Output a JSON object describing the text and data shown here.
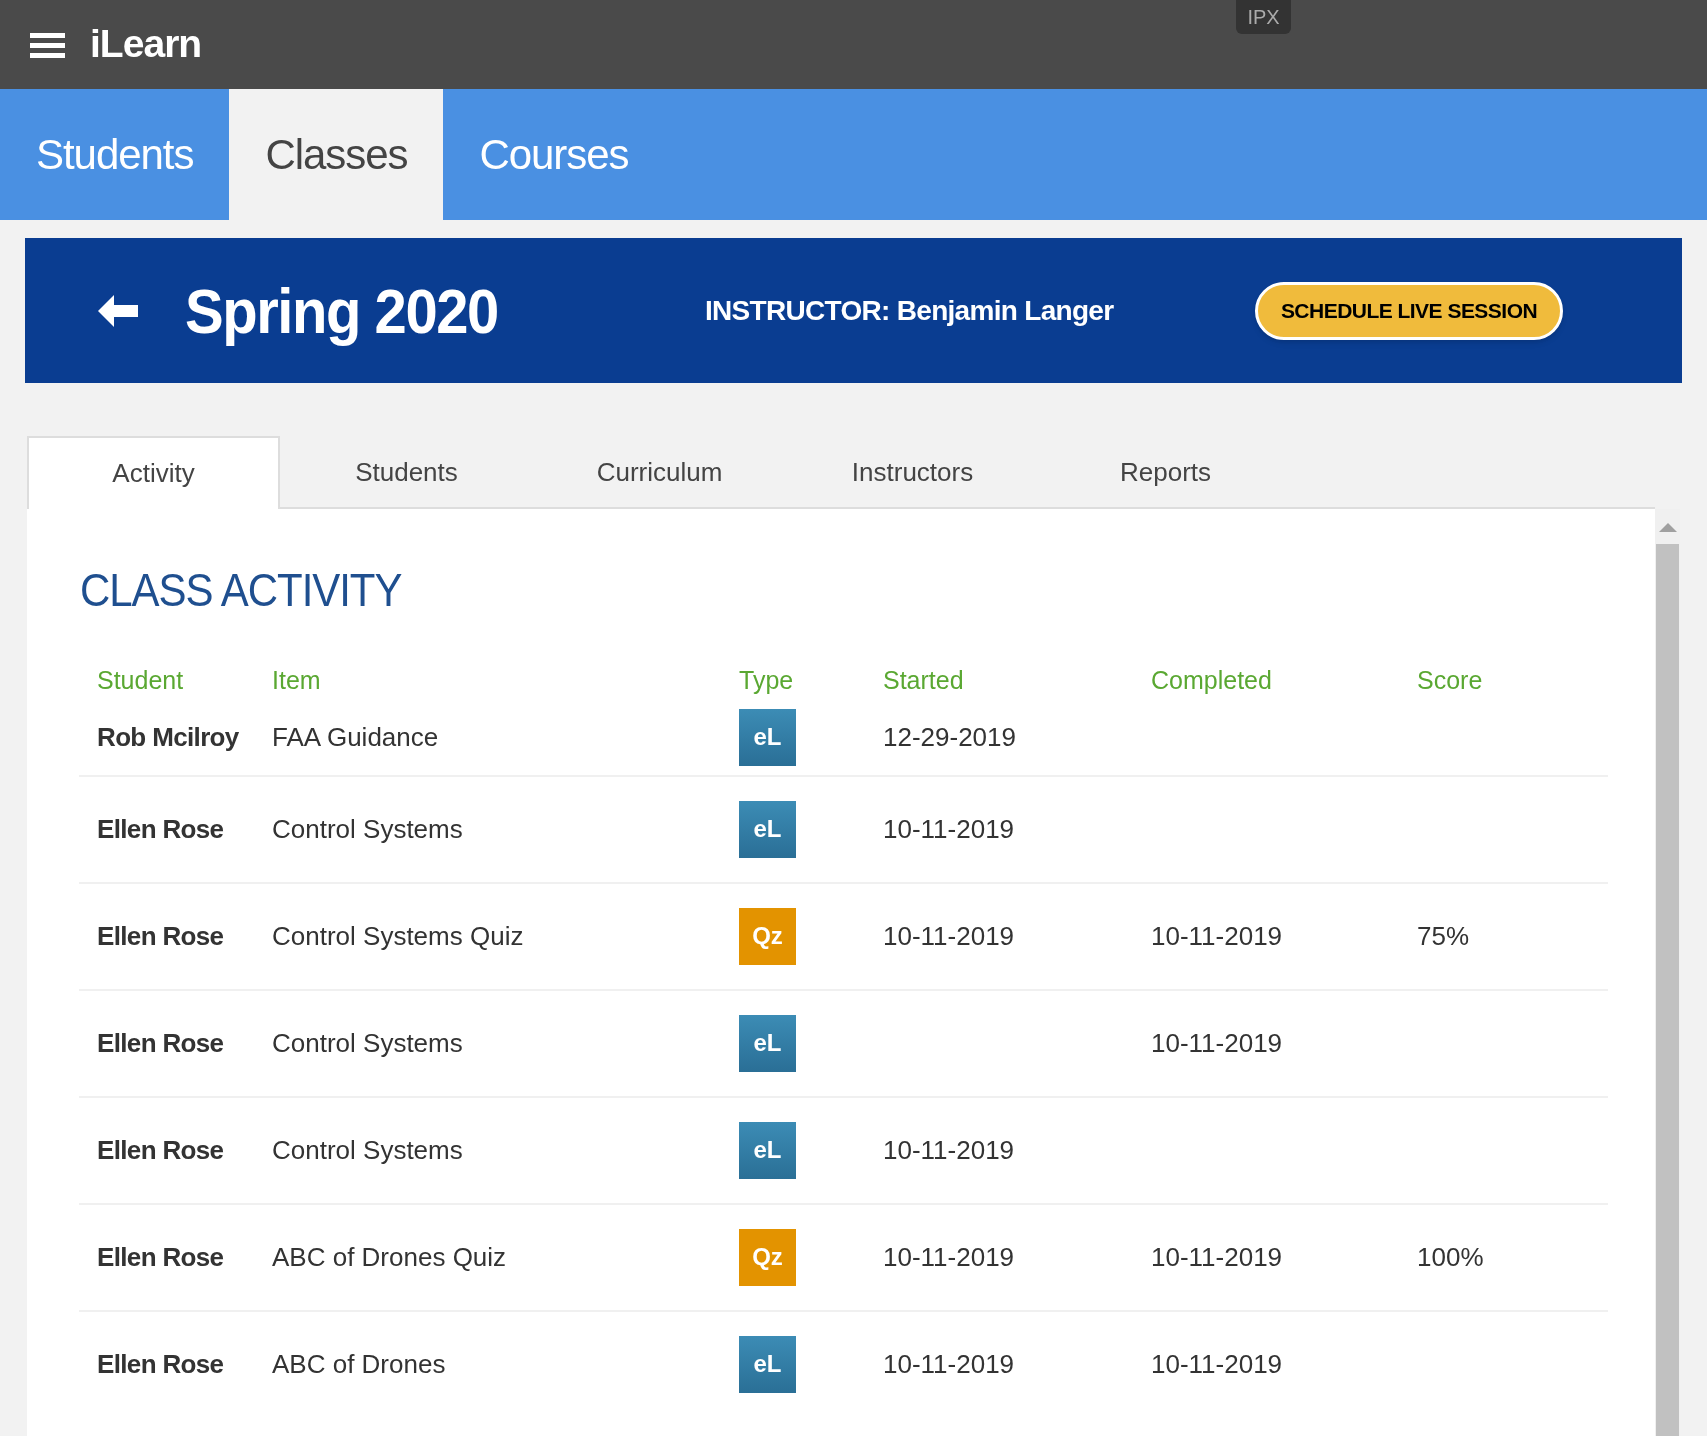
{
  "app": {
    "title": "iLearn",
    "badge": "IPX"
  },
  "nav_tabs": [
    {
      "label": "Students",
      "selected": false
    },
    {
      "label": "Classes",
      "selected": true
    },
    {
      "label": "Courses",
      "selected": false
    }
  ],
  "class_header": {
    "title": "Spring 2020",
    "instructor": "INSTRUCTOR: Benjamin Langer",
    "button": "SCHEDULE LIVE SESSION"
  },
  "tabs": [
    {
      "label": "Activity",
      "selected": true
    },
    {
      "label": "Students",
      "selected": false
    },
    {
      "label": "Curriculum",
      "selected": false
    },
    {
      "label": "Instructors",
      "selected": false
    },
    {
      "label": "Reports",
      "selected": false
    }
  ],
  "section_title": "CLASS ACTIVITY",
  "table": {
    "columns": [
      "Student",
      "Item",
      "Type",
      "Started",
      "Completed",
      "Score"
    ],
    "rows": [
      {
        "student": "Rob Mcilroy",
        "item": "FAA Guidance",
        "type": {
          "kind": "elearning",
          "label": "eL"
        },
        "started": "12-29-2019",
        "completed": "",
        "score": ""
      },
      {
        "student": "Ellen Rose",
        "item": "Control Systems",
        "type": {
          "kind": "elearning",
          "label": "eL"
        },
        "started": "10-11-2019",
        "completed": "",
        "score": ""
      },
      {
        "student": "Ellen Rose",
        "item": "Control Systems Quiz",
        "type": {
          "kind": "quiz",
          "label": "Qz"
        },
        "started": "10-11-2019",
        "completed": "10-11-2019",
        "score": "75%"
      },
      {
        "student": "Ellen Rose",
        "item": "Control Systems",
        "type": {
          "kind": "elearning",
          "label": "eL"
        },
        "started": "",
        "completed": "10-11-2019",
        "score": ""
      },
      {
        "student": "Ellen Rose",
        "item": "Control Systems",
        "type": {
          "kind": "elearning",
          "label": "eL"
        },
        "started": "10-11-2019",
        "completed": "",
        "score": ""
      },
      {
        "student": "Ellen Rose",
        "item": "ABC of Drones Quiz",
        "type": {
          "kind": "quiz",
          "label": "Qz"
        },
        "started": "10-11-2019",
        "completed": "10-11-2019",
        "score": "100%"
      },
      {
        "student": "Ellen Rose",
        "item": "ABC of Drones",
        "type": {
          "kind": "elearning",
          "label": "eL"
        },
        "started": "10-11-2019",
        "completed": "10-11-2019",
        "score": ""
      }
    ]
  }
}
